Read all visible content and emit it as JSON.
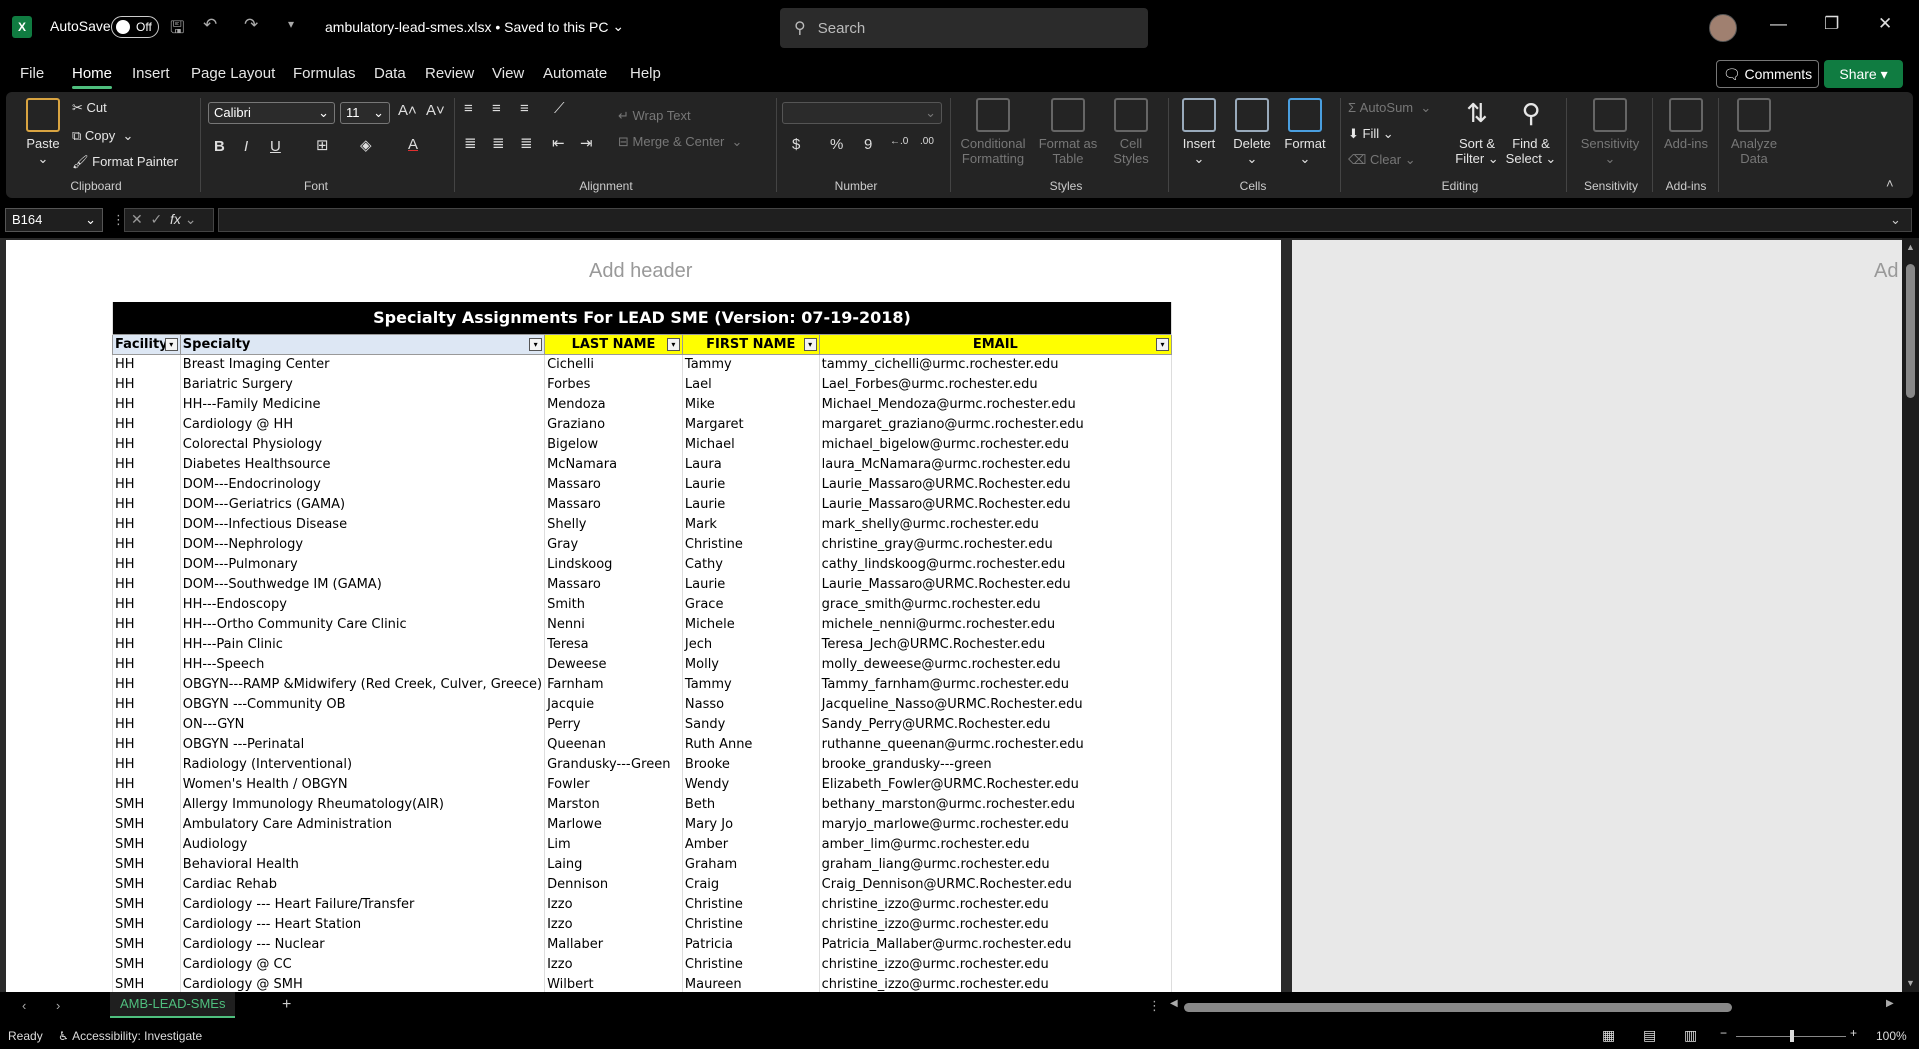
{
  "titlebar": {
    "autosave_label": "AutoSave",
    "autosave_state": "Off",
    "doc_title": "ambulatory-lead-smes.xlsx • Saved to this PC",
    "search_placeholder": "Search"
  },
  "menu": {
    "tabs": [
      "File",
      "Home",
      "Insert",
      "Page Layout",
      "Formulas",
      "Data",
      "Review",
      "View",
      "Automate",
      "Help"
    ],
    "active": "Home",
    "comments_label": "Comments",
    "share_label": "Share"
  },
  "ribbon": {
    "clipboard": {
      "paste": "Paste",
      "cut": "Cut",
      "copy": "Copy",
      "format_painter": "Format Painter",
      "label": "Clipboard"
    },
    "font": {
      "name": "Calibri",
      "size": "11",
      "label": "Font"
    },
    "alignment": {
      "wrap_text": "Wrap Text",
      "merge_center": "Merge & Center",
      "label": "Alignment"
    },
    "number": {
      "label": "Number",
      "currency": "$",
      "percent": "%",
      "comma": "9"
    },
    "styles": {
      "conditional": "Conditional Formatting",
      "format_table": "Format as Table",
      "cell_styles": "Cell Styles",
      "label": "Styles"
    },
    "cells": {
      "insert": "Insert",
      "delete": "Delete",
      "format": "Format",
      "label": "Cells"
    },
    "editing": {
      "autosum": "AutoSum",
      "fill": "Fill",
      "clear": "Clear",
      "sort": "Sort & Filter",
      "find": "Find & Select",
      "label": "Editing"
    },
    "sensitivity": {
      "btn": "Sensitivity",
      "label": "Sensitivity"
    },
    "addins": {
      "btn": "Add-ins",
      "label": "Add-ins"
    },
    "analyze": {
      "btn": "Analyze Data"
    }
  },
  "formula_bar": {
    "name_box": "B164",
    "fx": "fx",
    "formula": ""
  },
  "page": {
    "add_header": "Add header",
    "add_header_right": "Ad"
  },
  "table": {
    "title": "Specialty Assignments For LEAD SME (Version: 07-19-2018)",
    "headers": [
      "Facility",
      "Specialty",
      "LAST NAME",
      "FIRST NAME",
      "EMAIL"
    ],
    "rows": [
      [
        "HH",
        "Breast Imaging Center",
        "Cichelli",
        "Tammy",
        "tammy_cichelli@urmc.rochester.edu"
      ],
      [
        "HH",
        "Bariatric Surgery",
        "Forbes",
        "Lael",
        "Lael_Forbes@urmc.rochester.edu"
      ],
      [
        "HH",
        "HH---Family  Medicine",
        "Mendoza",
        "Mike",
        "Michael_Mendoza@urmc.rochester.edu"
      ],
      [
        "HH",
        "Cardiology @ HH",
        "Graziano",
        "Margaret",
        "margaret_graziano@urmc.rochester.edu"
      ],
      [
        "HH",
        "Colorectal Physiology",
        "Bigelow",
        "Michael",
        "michael_bigelow@urmc.rochester.edu"
      ],
      [
        "HH",
        "Diabetes Healthsource",
        "McNamara",
        "Laura",
        "laura_McNamara@urmc.rochester.edu"
      ],
      [
        "HH",
        "DOM---Endocrinology",
        "Massaro",
        "Laurie",
        "Laurie_Massaro@URMC.Rochester.edu"
      ],
      [
        "HH",
        "DOM---Geriatrics (GAMA)",
        "Massaro",
        "Laurie",
        "Laurie_Massaro@URMC.Rochester.edu"
      ],
      [
        "HH",
        "DOM---Infectious  Disease",
        "Shelly",
        "Mark",
        "mark_shelly@urmc.rochester.edu"
      ],
      [
        "HH",
        "DOM---Nephrology",
        "Gray",
        "Christine",
        "christine_gray@urmc.rochester.edu"
      ],
      [
        "HH",
        "DOM---Pulmonary",
        "Lindskoog",
        "Cathy",
        "cathy_lindskoog@urmc.rochester.edu"
      ],
      [
        "HH",
        "DOM---Southwedge IM (GAMA)",
        "Massaro",
        "Laurie",
        "Laurie_Massaro@URMC.Rochester.edu"
      ],
      [
        "HH",
        "HH---Endoscopy",
        "Smith",
        "Grace",
        "grace_smith@urmc.rochester.edu"
      ],
      [
        "HH",
        "HH---Ortho Community Care Clinic",
        "Nenni",
        "Michele",
        "michele_nenni@urmc.rochester.edu"
      ],
      [
        "HH",
        "HH---Pain Clinic",
        "Teresa",
        "Jech",
        "Teresa_Jech@URMC.Rochester.edu"
      ],
      [
        "HH",
        "HH---Speech",
        "Deweese",
        "Molly",
        "molly_deweese@urmc.rochester.edu"
      ],
      [
        "HH",
        "OBGYN---RAMP &Midwifery (Red Creek, Culver, Greece)",
        "Farnham",
        "Tammy",
        "Tammy_farnham@urmc.rochester.edu"
      ],
      [
        "HH",
        "OBGYN ---Community OB",
        "Jacquie",
        "Nasso",
        "Jacqueline_Nasso@URMC.Rochester.edu"
      ],
      [
        "HH",
        "ON---GYN",
        "Perry",
        "Sandy",
        "Sandy_Perry@URMC.Rochester.edu"
      ],
      [
        "HH",
        "OBGYN ---Perinatal",
        "Queenan",
        "Ruth Anne",
        "ruthanne_queenan@urmc.rochester.edu"
      ],
      [
        "HH",
        "Radiology (Interventional)",
        "Grandusky---Green",
        "Brooke",
        "brooke_grandusky---green"
      ],
      [
        "HH",
        "Women's Health / OBGYN",
        "Fowler",
        "Wendy",
        "Elizabeth_Fowler@URMC.Rochester.edu"
      ],
      [
        "SMH",
        "Allergy Immunology Rheumatology(AIR)",
        "Marston",
        "Beth",
        "bethany_marston@urmc.rochester.edu"
      ],
      [
        "SMH",
        "Ambulatory Care Administration",
        "Marlowe",
        "Mary Jo",
        "maryjo_marlowe@urmc.rochester.edu"
      ],
      [
        "SMH",
        "Audiology",
        "Lim",
        "Amber",
        "amber_lim@urmc.rochester.edu"
      ],
      [
        "SMH",
        "Behavioral Health",
        "Laing",
        "Graham",
        "graham_liang@urmc.rochester.edu"
      ],
      [
        "SMH",
        "Cardiac Rehab",
        "Dennison",
        "Craig",
        "Craig_Dennison@URMC.Rochester.edu"
      ],
      [
        "SMH",
        "Cardiology ---  Heart Failure/Transfer",
        "Izzo",
        "Christine",
        "christine_izzo@urmc.rochester.edu"
      ],
      [
        "SMH",
        "Cardiology --- Heart Station",
        "Izzo",
        "Christine",
        "christine_izzo@urmc.rochester.edu"
      ],
      [
        "SMH",
        "Cardiology --- Nuclear",
        "Mallaber",
        "Patricia",
        "Patricia_Mallaber@urmc.rochester.edu"
      ],
      [
        "SMH",
        "Cardiology @ CC",
        "Izzo",
        "Christine",
        "christine_izzo@urmc.rochester.edu"
      ],
      [
        "SMH",
        "Cardiology @ SMH",
        "Wilbert",
        "Maureen",
        "christine_izzo@urmc.rochester.edu"
      ]
    ]
  },
  "sheet_tabs": {
    "active": "AMB-LEAD-SMEs"
  },
  "status": {
    "ready": "Ready",
    "accessibility": "Accessibility: Investigate",
    "zoom": "100%"
  }
}
